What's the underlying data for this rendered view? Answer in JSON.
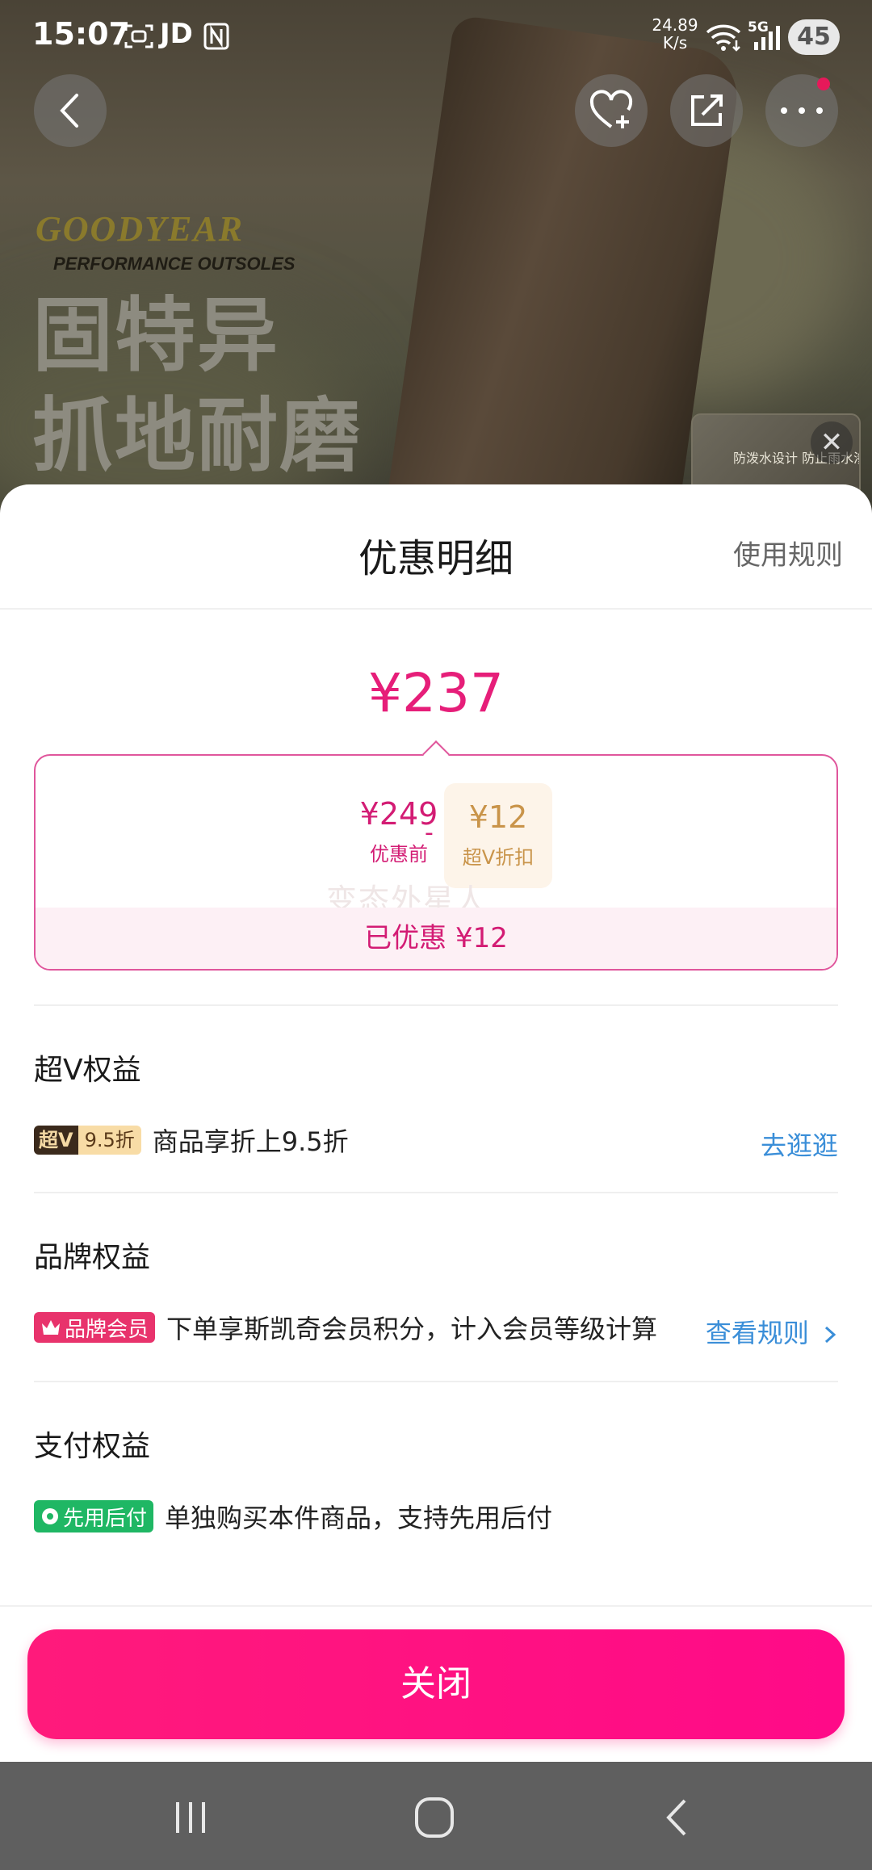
{
  "status_bar": {
    "time": "15:07",
    "carrier_label": "JD",
    "net_speed_value": "24.89",
    "net_speed_unit": "K/s",
    "network_type": "5G",
    "battery": "45"
  },
  "backdrop": {
    "brand_logo": "GOODYEAR",
    "brand_tagline": "PERFORMANCE OUTSOLES",
    "hero_line_1": "固特异",
    "hero_line_2": "抓地耐磨",
    "thumbnail_caption": "防泼水设计 防止雨水渗水"
  },
  "sheet": {
    "title": "优惠明细",
    "rules_link": "使用规则",
    "final_price": "¥237",
    "breakdown": {
      "before_value": "¥249",
      "before_label": "优惠前",
      "minus": "-",
      "discount_value": "¥12",
      "discount_label": "超V折扣",
      "watermark": "变态外星人",
      "saved_text": "已优惠 ¥12"
    },
    "sections": {
      "superv": {
        "title": "超V权益",
        "badge_left": "超V",
        "badge_right": "9.5折",
        "text": "商品享折上9.5折",
        "link": "去逛逛"
      },
      "brand": {
        "title": "品牌权益",
        "badge": "品牌会员",
        "text": "下单享斯凯奇会员积分，计入会员等级计算",
        "link": "查看规则"
      },
      "payment": {
        "title": "支付权益",
        "badge": "先用后付",
        "text": "单独购买本件商品，支持先用后付"
      }
    },
    "close_button": "关闭"
  },
  "icons": {
    "back": "chevron-left-icon",
    "favorite": "heart-plus-icon",
    "share": "share-icon",
    "more": "more-dots-icon",
    "thumb_close": "close-icon",
    "brand_badge": "crown-icon",
    "pay_badge": "flower-icon",
    "link_arrow": "chevron-right-icon"
  },
  "colors": {
    "accent": "#e61e79",
    "button": "#ff0a88",
    "link": "#3a8ed8",
    "discount": "#c9944a",
    "pay_badge": "#1fb764"
  }
}
